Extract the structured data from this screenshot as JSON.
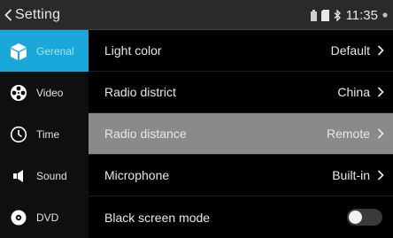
{
  "header": {
    "back_label": "Setting",
    "time": "11:35"
  },
  "sidebar": {
    "items": [
      {
        "label": "Gerenal",
        "icon": "general-icon",
        "active": true
      },
      {
        "label": "Video",
        "icon": "video-reel-icon",
        "active": false
      },
      {
        "label": "Time",
        "icon": "clock-icon",
        "active": false
      },
      {
        "label": "Sound",
        "icon": "speaker-icon",
        "active": false
      },
      {
        "label": "DVD",
        "icon": "disc-icon",
        "active": false
      }
    ]
  },
  "settings": {
    "rows": [
      {
        "label": "Light color",
        "value": "Default"
      },
      {
        "label": "Radio district",
        "value": "China"
      },
      {
        "label": "Radio distance",
        "value": "Remote",
        "highlighted": true
      },
      {
        "label": "Microphone",
        "value": "Built-in"
      },
      {
        "label": "Black screen mode",
        "toggle": "off"
      }
    ]
  },
  "colors": {
    "accent": "#1aa7d9",
    "highlight_row": "#8a8a8a",
    "topbar": "#2a2a2a"
  }
}
